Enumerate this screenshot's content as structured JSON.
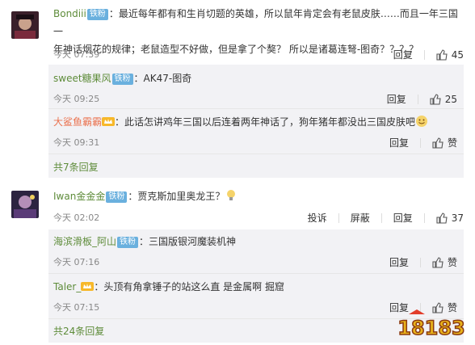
{
  "comments": [
    {
      "user": "Bondiii",
      "badge": "铁粉",
      "text_line1": "：最近每年都有和生肖切题的英雄，所以鼠年肯定会有老鼠皮肤……而且一年三国一",
      "text_line2": "年神话烟花的规律；老鼠造型不好做，但是拿了个獒？ 所以是诸葛连弩-图奇？？？？",
      "time": "今天 07:39",
      "reply_label": "回复",
      "likes": "45",
      "replies": [
        {
          "user": "sweet糖果风",
          "badge": "铁粉",
          "text": "：AK47-图奇",
          "time": "今天 09:25",
          "reply_label": "回复",
          "likes": "25"
        },
        {
          "user": "大鲨鱼霸霸",
          "badge": "粉",
          "text": "：此话怎讲鸡年三国以后连着两年神话了，狗年猪年都没出三国皮肤吧",
          "time": "今天 09:31",
          "reply_label": "回复",
          "likes": "赞"
        }
      ],
      "more": "共7条回复"
    },
    {
      "user": "Iwan金金金",
      "badge": "铁粉",
      "text": "：贾克斯加里奥龙王？",
      "time": "今天 02:02",
      "report_label": "投诉",
      "block_label": "屏蔽",
      "reply_label": "回复",
      "likes": "37",
      "replies": [
        {
          "user": "海滨滑板_阿山",
          "badge": "铁粉",
          "text": "：三国版银河魔装机神",
          "time": "今天 07:16",
          "reply_label": "回复",
          "likes": "赞"
        },
        {
          "user": "Taler_",
          "badge": "粉",
          "text": "：头顶有角拿锤子的站这么直 是金属啊  掘窟",
          "time": "今天 07:15",
          "reply_label": "回复",
          "likes": "赞"
        }
      ],
      "more": "共24条回复"
    }
  ],
  "watermark": "18183",
  "colors": {
    "username": "#5e8c3a",
    "orange_username": "#eb7350",
    "badge": "#6ab0de",
    "reply_bg": "#f2f2f5"
  }
}
